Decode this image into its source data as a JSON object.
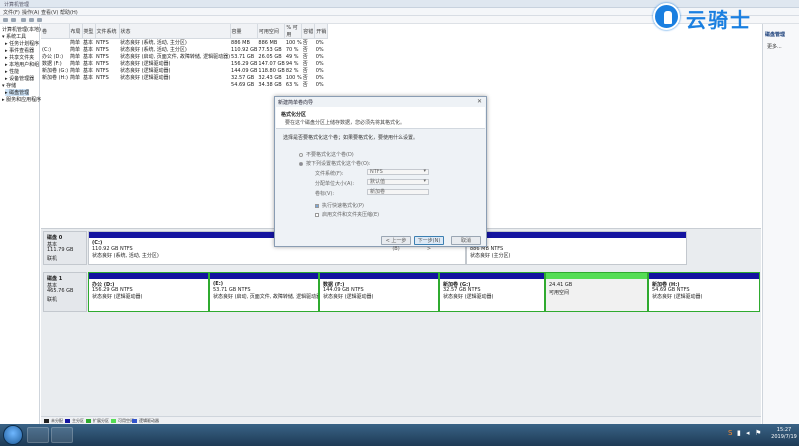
{
  "window": {
    "title": "计算机管理"
  },
  "menu": [
    "文件(F)",
    "操作(A)",
    "查看(V)",
    "帮助(H)"
  ],
  "tree": [
    "计算机管理(本地)",
    "▾ 系统工具",
    "▸ 任务计划程序",
    "▸ 事件查看器",
    "▸ 共享文件夹",
    "▸ 本地用户和组",
    "▸ 性能",
    "▸ 设备管理器",
    "▾ 存储",
    "▸ 磁盘管理",
    "▸ 服务和应用程序"
  ],
  "volume_table": {
    "headers": [
      "卷",
      "布局",
      "类型",
      "文件系统",
      "状态",
      "容量",
      "可用空间",
      "% 可用",
      "容错",
      "开销"
    ],
    "rows": [
      [
        "",
        "简单",
        "基本",
        "NTFS",
        "状态良好 (系统, 活动, 主分区)",
        "886 MB",
        "886 MB",
        "100 %",
        "否",
        "0%"
      ],
      [
        "(C:)",
        "简单",
        "基本",
        "NTFS",
        "状态良好 (系统, 活动, 主分区)",
        "110.92 GB",
        "77.53 GB",
        "70 %",
        "否",
        "0%"
      ],
      [
        "办公 (D:)",
        "简单",
        "基本",
        "NTFS",
        "状态良好 (启动, 页面文件, 故障转储, 逻辑驱动器)",
        "53.71 GB",
        "26.05 GB",
        "49 %",
        "否",
        "0%"
      ],
      [
        "数据 (F:)",
        "简单",
        "基本",
        "NTFS",
        "状态良好 (逻辑驱动器)",
        "156.29 GB",
        "147.07 GB",
        "94 %",
        "否",
        "0%"
      ],
      [
        "新加卷 (G:)",
        "简单",
        "基本",
        "NTFS",
        "状态良好 (逻辑驱动器)",
        "144.09 GB",
        "118.80 GB",
        "82 %",
        "否",
        "0%"
      ],
      [
        "新加卷 (H:)",
        "简单",
        "基本",
        "NTFS",
        "状态良好 (逻辑驱动器)",
        "32.57 GB",
        "32.43 GB",
        "100 %",
        "否",
        "0%"
      ],
      [
        "",
        "",
        "",
        "",
        "",
        "54.69 GB",
        "34.38 GB",
        "63 %",
        "否",
        "0%"
      ]
    ]
  },
  "actions": {
    "header": "磁盘管理",
    "more": "更多..."
  },
  "disk0": {
    "name": "磁盘 0",
    "type": "基本",
    "size": "111.79 GB",
    "status": "联机",
    "parts": [
      {
        "name": "(C:)",
        "size": "110.92 GB NTFS",
        "status": "状态良好 (系统, 活动, 主分区)"
      },
      {
        "name": "",
        "size": "886 MB NTFS",
        "status": "状态良好 (主分区)"
      }
    ]
  },
  "disk1": {
    "name": "磁盘 1",
    "type": "基本",
    "size": "465.76 GB",
    "status": "联机",
    "parts": [
      {
        "name": "办公 (D:)",
        "size": "156.29 GB NTFS",
        "status": "状态良好 (逻辑驱动器)"
      },
      {
        "name": "(E:)",
        "size": "53.71 GB NTFS",
        "status": "状态良好 (启动, 页面文件, 故障转储, 逻辑驱动器)"
      },
      {
        "name": "数据 (F:)",
        "size": "144.09 GB NTFS",
        "status": "状态良好 (逻辑驱动器)"
      },
      {
        "name": "新加卷 (G:)",
        "size": "32.57 GB NTFS",
        "status": "状态良好 (逻辑驱动器)"
      },
      {
        "name": "",
        "size": "24.41 GB",
        "status": "可用空间"
      },
      {
        "name": "新加卷 (H:)",
        "size": "54.69 GB NTFS",
        "status": "状态良好 (逻辑驱动器)"
      }
    ]
  },
  "legend": [
    "未分配",
    "主分区",
    "扩展分区",
    "可用空间",
    "逻辑驱动器"
  ],
  "dialog": {
    "title": "新建简单卷向导",
    "close": "✕",
    "heading": "格式化分区",
    "subheading": "要在这个磁盘分区上储存数据，您必须先将其格式化。",
    "desc": "选择是否要格式化这个卷；如果要格式化，要使用什么设置。",
    "opt1": "不要格式化这个卷(D)",
    "opt2": "按下列设置格式化这个卷(O):",
    "fs_label": "文件系统(F):",
    "fs_value": "NTFS",
    "alloc_label": "分配单位大小(A):",
    "alloc_value": "默认值",
    "vol_label": "卷标(V):",
    "vol_value": "新加卷",
    "quick": "执行快速格式化(P)",
    "compress": "启用文件和文件夹压缩(E)",
    "back": "< 上一步(B)",
    "next": "下一步(N) >",
    "cancel": "取消"
  },
  "logo": {
    "text": "云骑士"
  },
  "clock": {
    "time": "15:27",
    "date": "2019/7/19"
  },
  "colors": {
    "primary_bar": "#1414a0",
    "free_bar": "#55dd55",
    "logical_border": "#2faa2f",
    "accent": "#1a7fe0"
  }
}
